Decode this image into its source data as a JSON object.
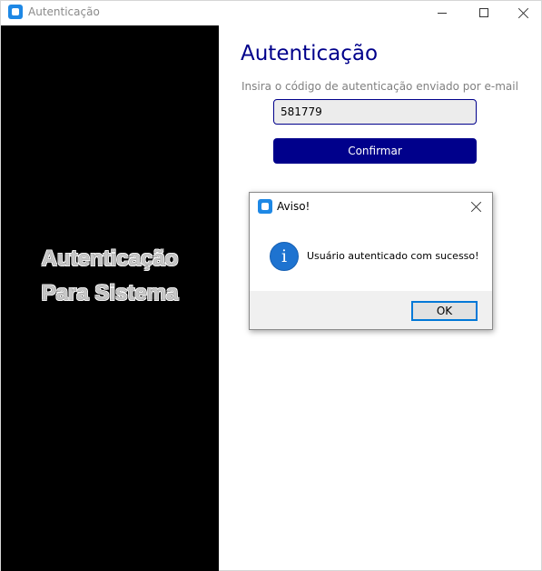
{
  "window": {
    "title": "Autenticação"
  },
  "left_panel": {
    "line1": "Autenticação",
    "line2": "Para Sistema"
  },
  "form": {
    "heading": "Autenticação",
    "instructions": "Insira o código de autenticação enviado por e-mail",
    "code_value": "581779",
    "confirm_label": "Confirmar"
  },
  "dialog": {
    "title": "Aviso!",
    "message": "Usuário autenticado com sucesso!",
    "ok_label": "OK",
    "info_glyph": "i"
  },
  "colors": {
    "accent": "#00008b",
    "left_panel_bg": "#000000",
    "info_icon": "#1e73d0"
  },
  "icons": [
    "app-icon",
    "minimize-icon",
    "maximize-icon",
    "close-icon",
    "info-icon"
  ]
}
